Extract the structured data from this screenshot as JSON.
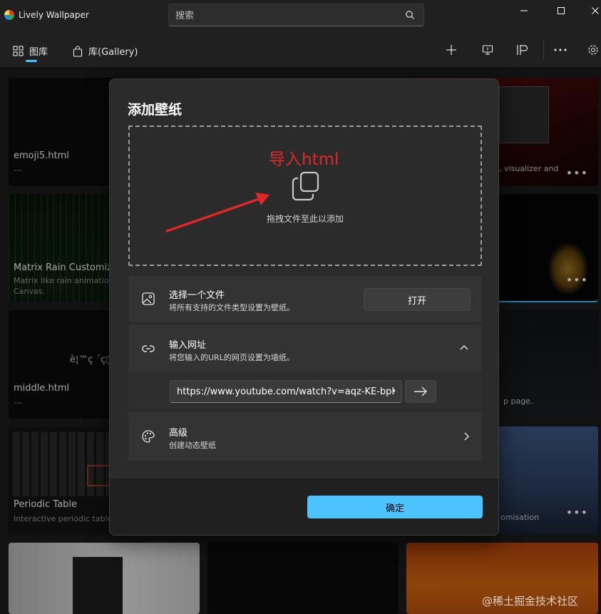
{
  "app": {
    "title": "Lively Wallpaper"
  },
  "search": {
    "placeholder": "搜索"
  },
  "nav": {
    "tabs": [
      {
        "label": "图库",
        "icon": "grid-icon"
      },
      {
        "label": "库(Gallery)",
        "icon": "shopping-bag-icon"
      }
    ],
    "tools": [
      "add-icon",
      "screen-icon",
      "pause-flag-icon",
      "more-icon",
      "settings-icon"
    ]
  },
  "gallery": {
    "cards": [
      {
        "title": "emoji5.html",
        "desc": "---"
      },
      {
        "title": "Matrix Rain Customiza",
        "desc": "Matrix like rain animation\nCanvas."
      },
      {
        "title": "middle.html",
        "desc": "---",
        "overlay_text": "è¦™ç ´ç□"
      },
      {
        "title": "Periodic Table",
        "desc": "Interactive periodic table"
      },
      {
        "partial_desc": "c, visualizer and"
      },
      {
        "partial_desc": "p page."
      },
      {
        "partial_desc": "omisation"
      }
    ]
  },
  "dialog": {
    "title": "添加壁纸",
    "annotation": "导入html",
    "drop_hint": "拖拽文件至此以添加",
    "file": {
      "title": "选择一个文件",
      "subtitle": "将所有支持的文件类型设置为壁纸。",
      "button": "打开"
    },
    "url": {
      "title": "输入网址",
      "subtitle": "将您输入的URL的网页设置为墙纸。",
      "value": "https://www.youtube.com/watch?v=aqz-KE-bpKQ"
    },
    "advanced": {
      "title": "高级",
      "subtitle": "创建动态壁纸"
    },
    "ok_button": "确定"
  },
  "watermark": "@稀土掘金技术社区",
  "colors": {
    "accent": "#4cc2ff",
    "annotation": "#e02828"
  }
}
